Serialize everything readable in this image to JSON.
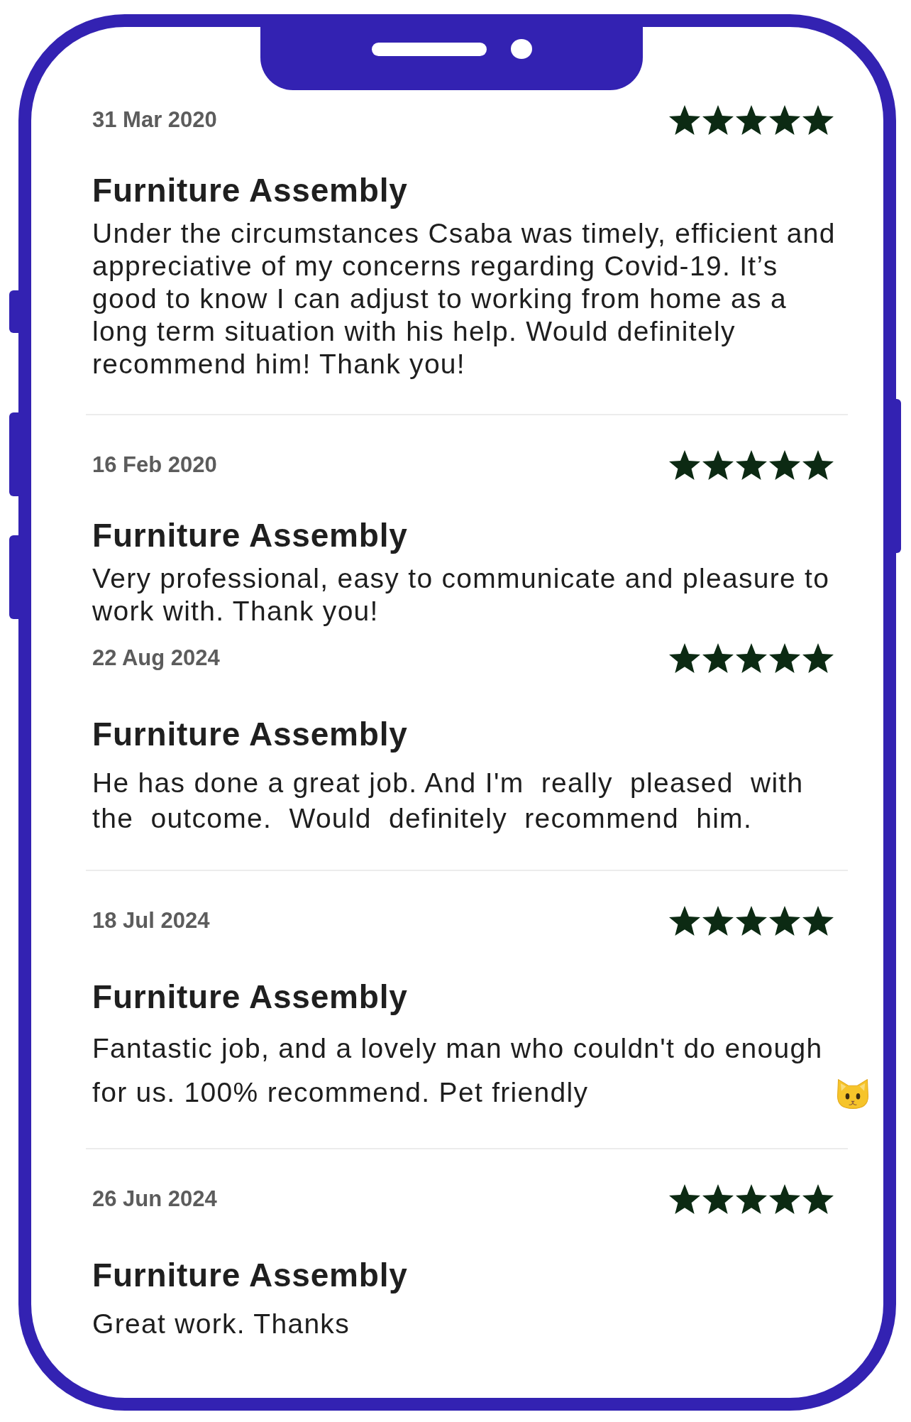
{
  "reviews": [
    {
      "date": "31 Mar 2020",
      "stars": 5,
      "title": "Furniture Assembly",
      "text": "Under the circumstances Csaba was timely, efficient and appreciative of my concerns regarding Covid-19. It’s good to know I can adjust to working from home as a long term situation with his help. Would definitely recommend him! Thank you!",
      "has_emoji": false,
      "divider_below": true
    },
    {
      "date": "16 Feb 2020",
      "stars": 5,
      "title": "Furniture Assembly",
      "text": "Very professional, easy to communicate and pleasure to work with. Thank you!",
      "has_emoji": false,
      "divider_below": false
    },
    {
      "date": "22 Aug 2024",
      "stars": 5,
      "title": "Furniture Assembly",
      "text": "He has done a great job. And I'm  really  pleased  with the  outcome.  Would  definitely  recommend  him.",
      "has_emoji": false,
      "divider_below": true
    },
    {
      "date": "18 Jul 2024",
      "stars": 5,
      "title": "Furniture Assembly",
      "text": "Fantastic job, and a lovely man who couldn't do enough for us. 100% recommend. Pet friendly",
      "has_emoji": true,
      "divider_below": true
    },
    {
      "date": "26 Jun 2024",
      "stars": 5,
      "title": "Furniture Assembly",
      "text": "Great work. Thanks",
      "has_emoji": false,
      "divider_below": false
    }
  ]
}
